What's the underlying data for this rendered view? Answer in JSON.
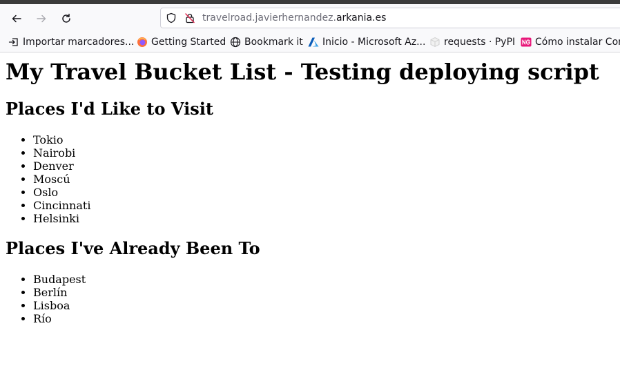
{
  "browser": {
    "url_host_start": "travelroad.javierhernandez.",
    "url_host_end": "arkania.es"
  },
  "bookmarks": [
    {
      "label": "Importar marcadores...",
      "icon": "import-icon"
    },
    {
      "label": "Getting Started",
      "icon": "firefox-icon"
    },
    {
      "label": "Bookmark it",
      "icon": "globe-icon"
    },
    {
      "label": "Inicio - Microsoft Az...",
      "icon": "azure-icon"
    },
    {
      "label": "requests · PyPI",
      "icon": "pypi-icon"
    },
    {
      "label": "Cómo instalar Com",
      "icon": "ng-icon"
    }
  ],
  "page": {
    "title": "My Travel Bucket List - Testing deploying script",
    "to_visit_heading": "Places I'd Like to Visit",
    "to_visit": [
      "Tokio",
      "Nairobi",
      "Denver",
      "Moscú",
      "Oslo",
      "Cincinnati",
      "Helsinki"
    ],
    "visited_heading": "Places I've Already Been To",
    "visited": [
      "Budapest",
      "Berlín",
      "Lisboa",
      "Río"
    ]
  }
}
